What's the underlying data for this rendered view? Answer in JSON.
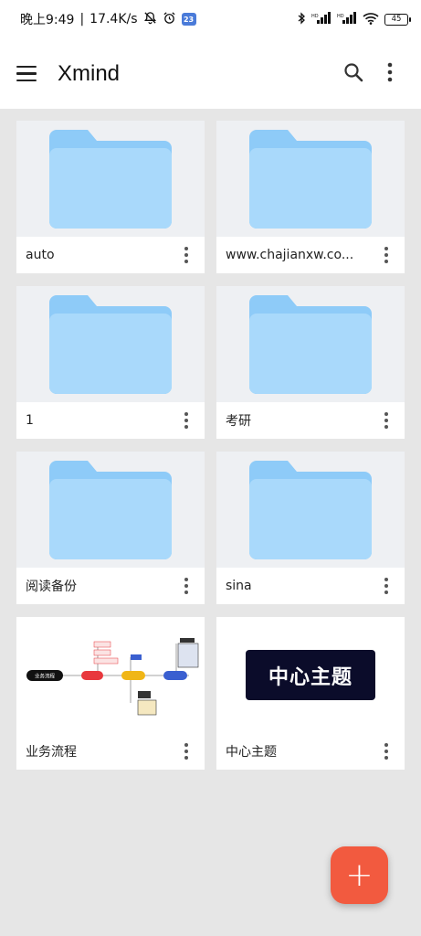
{
  "status": {
    "time": "晚上9:49",
    "speed": "17.4K/s",
    "badge": "23",
    "battery": "45"
  },
  "appbar": {
    "title": "Xmind"
  },
  "cards": [
    {
      "name": "auto",
      "kind": "folder"
    },
    {
      "name": "www.chajianxw.co...",
      "kind": "folder"
    },
    {
      "name": "1",
      "kind": "folder"
    },
    {
      "name": "考研",
      "kind": "folder"
    },
    {
      "name": "阅读备份",
      "kind": "folder"
    },
    {
      "name": "sina",
      "kind": "folder"
    },
    {
      "name": "业务流程",
      "kind": "mindmap"
    },
    {
      "name": "中心主题",
      "kind": "topic",
      "topic_text": "中心主题"
    }
  ],
  "colors": {
    "accent": "#f25a3f",
    "folder": "#9fd4fb",
    "folder_tab": "#8ecbf8",
    "topic_bg": "#0b0c2a"
  },
  "mindmap_labels": {
    "root": "业务流程"
  },
  "fab": {
    "label": "+"
  }
}
